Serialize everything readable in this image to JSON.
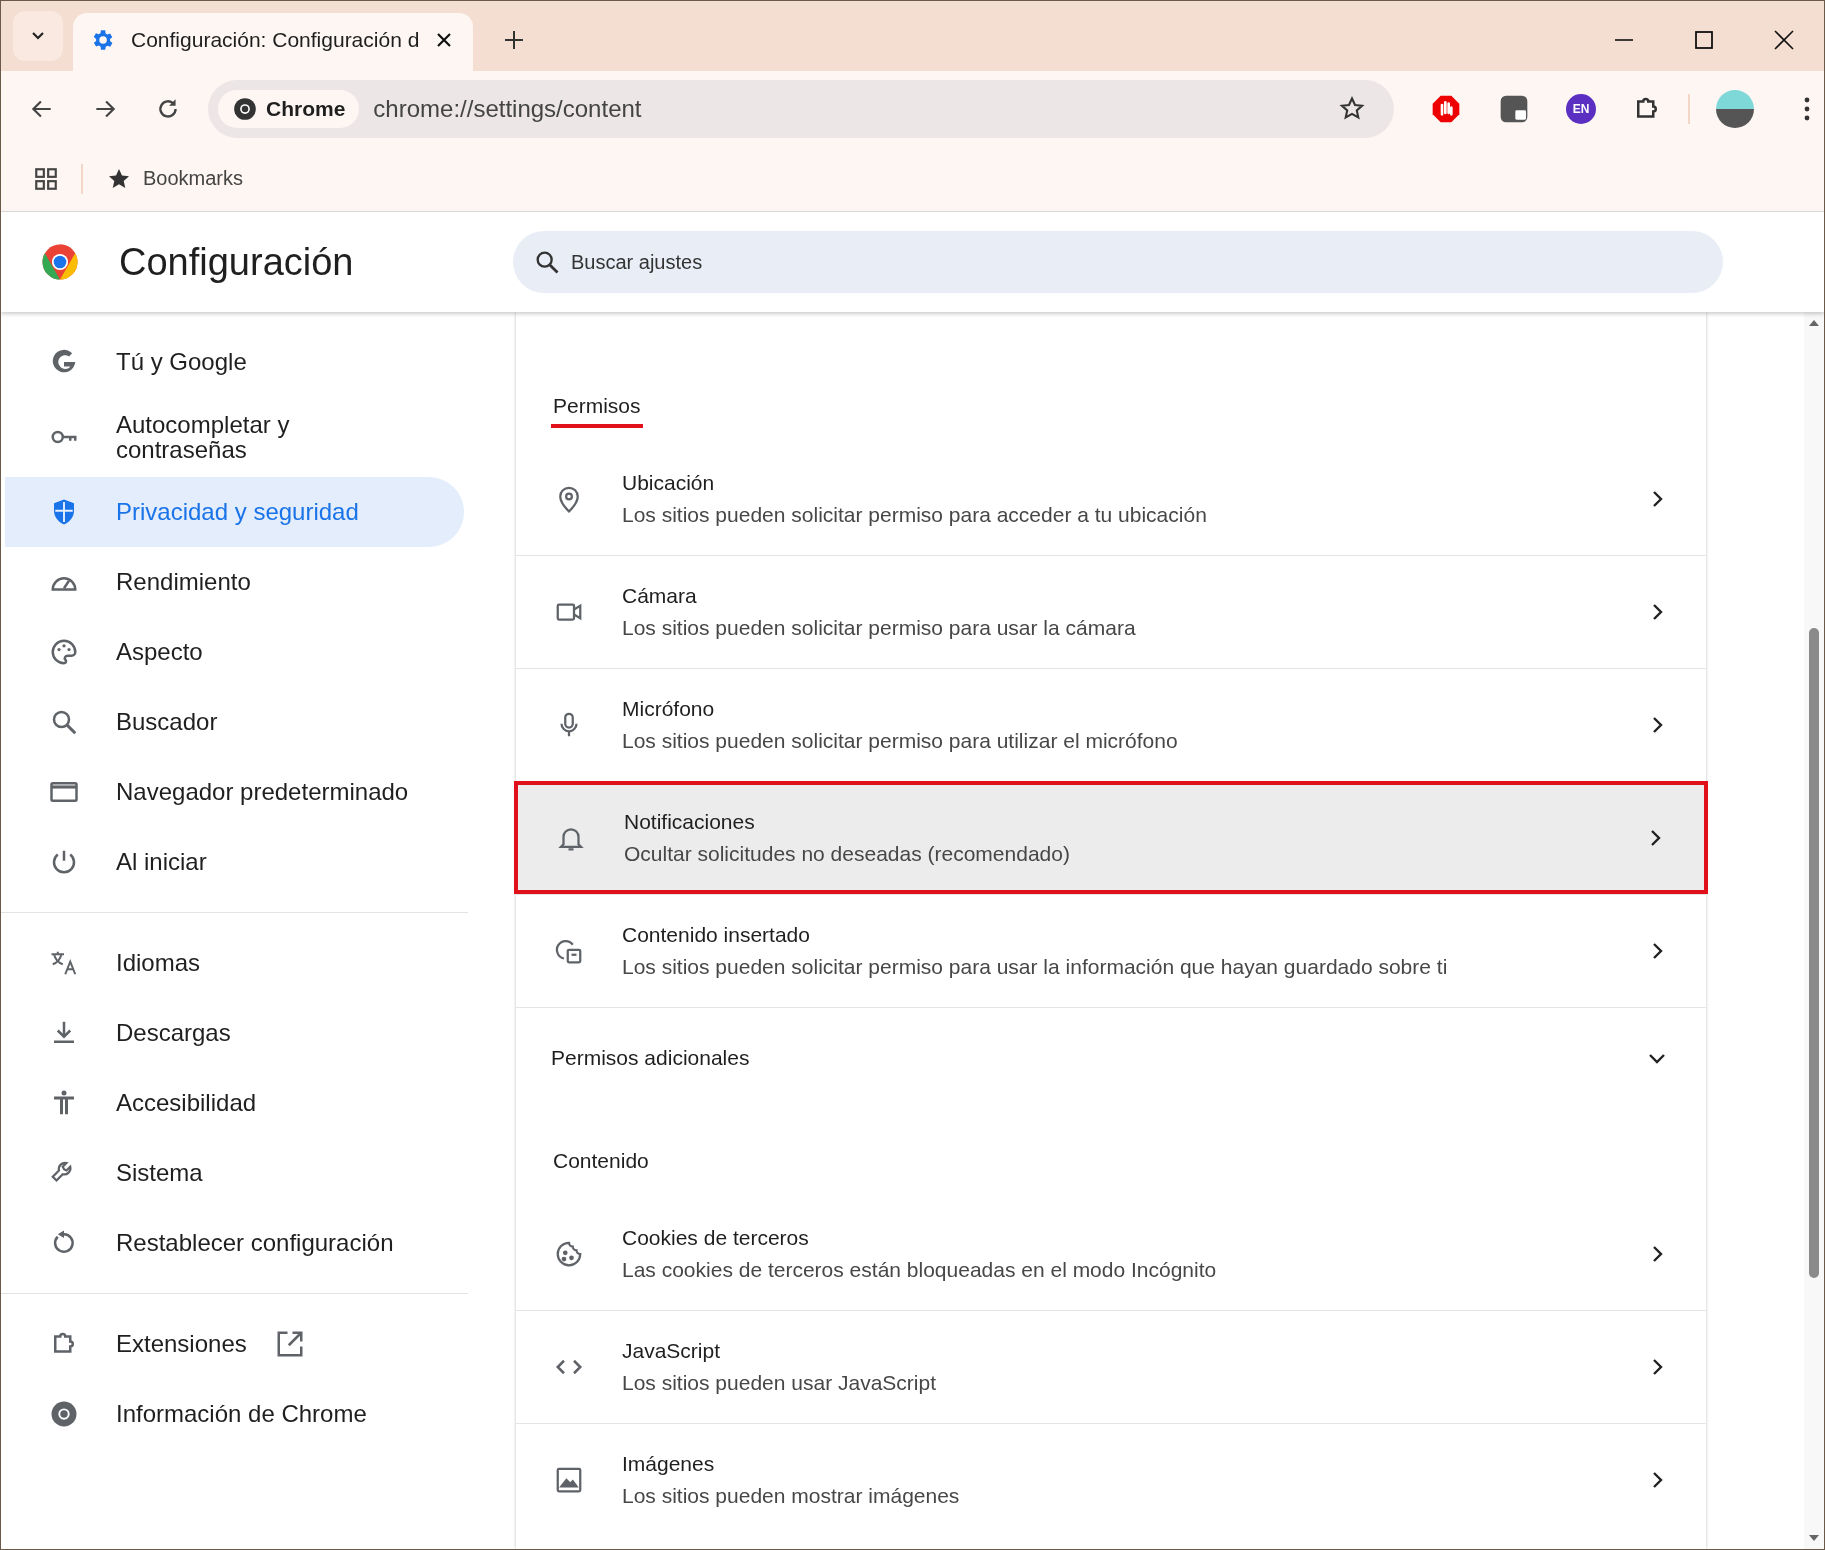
{
  "browser": {
    "tab": {
      "title": "Configuración: Configuración d",
      "selected": true
    },
    "omnibox": {
      "chip": "Chrome",
      "url": "chrome://settings/content"
    },
    "language_badge": "EN",
    "bookmarks": [
      "Bookmarks"
    ]
  },
  "header": {
    "title": "Configuración",
    "search": {
      "placeholder": "Buscar ajustes"
    }
  },
  "sidebar": {
    "groups": [
      {
        "items": [
          {
            "label": "Tú y Google",
            "kind": "google",
            "selected": false
          },
          {
            "label": "Autocompletar y contraseñas",
            "kind": "key",
            "selected": false
          },
          {
            "label": "Privacidad y seguridad",
            "kind": "shield",
            "selected": true
          },
          {
            "label": "Rendimiento",
            "kind": "gauge",
            "selected": false
          },
          {
            "label": "Aspecto",
            "kind": "palette",
            "selected": false
          },
          {
            "label": "Buscador",
            "kind": "search",
            "selected": false
          },
          {
            "label": "Navegador predeterminado",
            "kind": "window",
            "selected": false
          },
          {
            "label": "Al iniciar",
            "kind": "power",
            "selected": false
          }
        ]
      },
      {
        "items": [
          {
            "label": "Idiomas",
            "kind": "translate",
            "selected": false
          },
          {
            "label": "Descargas",
            "kind": "download",
            "selected": false
          },
          {
            "label": "Accesibilidad",
            "kind": "accessibility",
            "selected": false
          },
          {
            "label": "Sistema",
            "kind": "wrench",
            "selected": false
          },
          {
            "label": "Restablecer configuración",
            "kind": "reset",
            "selected": false
          }
        ]
      },
      {
        "items": [
          {
            "label": "Extensiones",
            "kind": "puzzle",
            "selected": false,
            "external": true
          },
          {
            "label": "Información de Chrome",
            "kind": "chrome",
            "selected": false,
            "external": false
          }
        ]
      }
    ]
  },
  "sections": [
    {
      "heading": "Permisos",
      "underlined": true,
      "rows": [
        {
          "kind": "location",
          "title": "Ubicación",
          "description": "Los sitios pueden solicitar permiso para acceder a tu ubicación",
          "highlighted": false
        },
        {
          "kind": "camera",
          "title": "Cámara",
          "description": "Los sitios pueden solicitar permiso para usar la cámara",
          "highlighted": false
        },
        {
          "kind": "mic",
          "title": "Micrófono",
          "description": "Los sitios pueden solicitar permiso para utilizar el micrófono",
          "highlighted": false
        },
        {
          "kind": "bell",
          "title": "Notificaciones",
          "description": "Ocultar solicitudes no deseadas (recomendado)",
          "highlighted": true
        },
        {
          "kind": "embedded",
          "title": "Contenido insertado",
          "description": "Los sitios pueden solicitar permiso para usar la información que hayan guardado sobre ti",
          "highlighted": false
        }
      ],
      "expander": {
        "label": "Permisos adicionales",
        "expanded": false
      }
    },
    {
      "heading": "Contenido",
      "underlined": false,
      "rows": [
        {
          "kind": "cookie",
          "title": "Cookies de terceros",
          "description": "Las cookies de terceros están bloqueadas en el modo Incógnito",
          "highlighted": false
        },
        {
          "kind": "code",
          "title": "JavaScript",
          "description": "Los sitios pueden usar JavaScript",
          "highlighted": false
        },
        {
          "kind": "image",
          "title": "Imágenes",
          "description": "Los sitios pueden mostrar imágenes",
          "highlighted": false
        }
      ]
    }
  ]
}
